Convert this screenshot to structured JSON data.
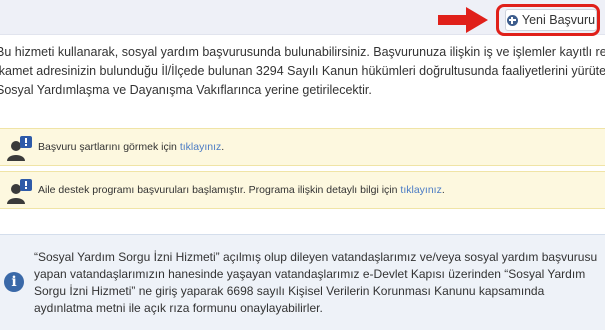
{
  "header": {
    "new_application_label": "Yeni Başvuru",
    "new_application_icon": "plus-circle-icon",
    "highlight_color": "#e0201a"
  },
  "intro": {
    "lines": [
      "Bu hizmeti kullanarak, sosyal yardım başvurusunda bulunabilirsiniz. Başvurunuza ilişkin iş ve işlemler kayıtlı resmi",
      "ikamet adresinizin bulunduğu İl/İlçede bulunan 3294 Sayılı Kanun hükümleri doğrultusunda faaliyetlerini yürüten",
      "Sosyal Yardımlaşma ve Dayanışma Vakıflarınca yerine getirilecektir."
    ]
  },
  "notices": [
    {
      "icon": "person-alert-icon",
      "text": "Başvuru şartlarını görmek için ",
      "link": "tıklayınız",
      "suffix": "."
    },
    {
      "icon": "person-alert-icon",
      "text": "Aile destek programı başvuruları başlamıştır. Programa ilişkin detaylı bilgi için ",
      "link": "tıklayınız",
      "suffix": "."
    }
  ],
  "info": {
    "icon": "info-icon",
    "lines": [
      "“Sosyal Yardım Sorgu İzni Hizmeti” açılmış olup dileyen vatandaşlarımız ve/veya sosyal yardım başvurusu",
      "yapan vatandaşlarımızın hanesinde yaşayan vatandaşlarımız e-Devlet Kapısı üzerinden “Sosyal Yardım",
      "Sorgu İzni Hizmeti” ne giriş yaparak 6698 sayılı Kişisel Verilerin Korunması Kanunu kapsamında",
      "aydınlatma metni ile açık rıza formunu onaylayabilirler."
    ]
  }
}
